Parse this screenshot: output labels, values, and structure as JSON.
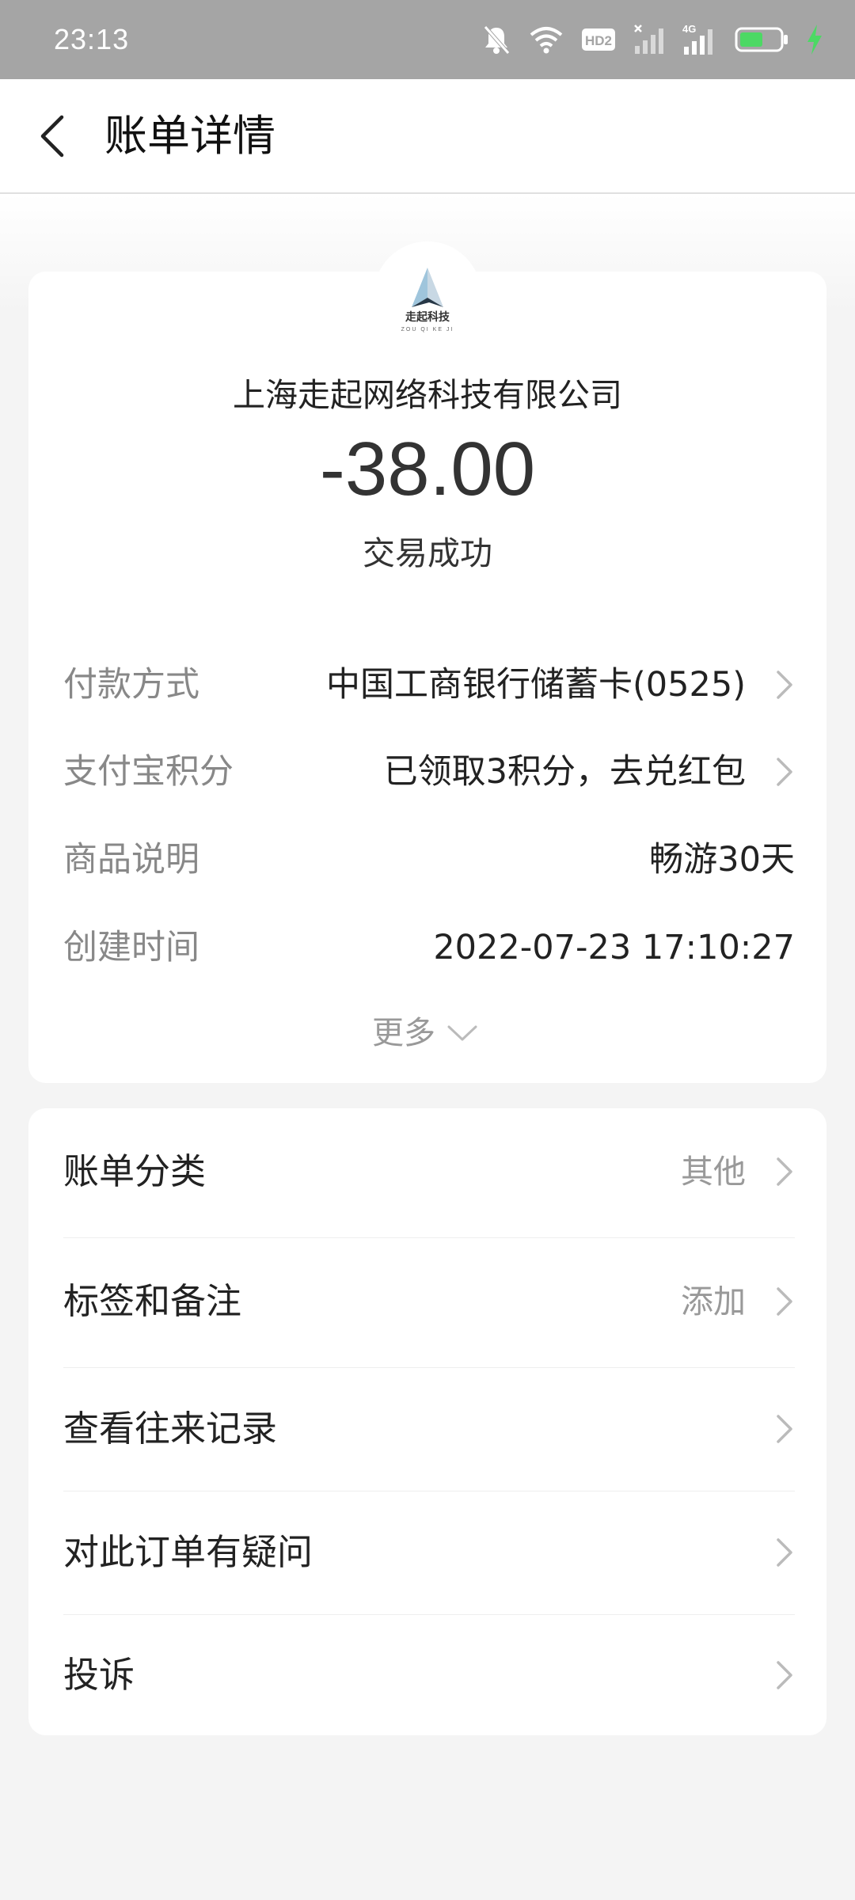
{
  "status_bar": {
    "time": "23:13",
    "icons": [
      "mute-bell-icon",
      "wifi-icon",
      "hd-icon",
      "signal-icon",
      "signal-4g-icon",
      "battery-icon",
      "charging-icon"
    ],
    "hd_label": "HD2",
    "network_label": "4G",
    "battery_color": "#4cd964"
  },
  "header": {
    "title": "账单详情"
  },
  "summary": {
    "merchant_name": "上海走起网络科技有限公司",
    "logo_text": "走起科技",
    "logo_subtext": "ZOU QI KE JI",
    "amount": "-38.00",
    "status": "交易成功",
    "details": [
      {
        "label": "付款方式",
        "value": "中国工商银行储蓄卡(0525)"
      },
      {
        "label": "支付宝积分",
        "value": "已领取3积分，去兑红包"
      },
      {
        "label": "商品说明",
        "value": "畅游30天"
      },
      {
        "label": "创建时间",
        "value": "2022-07-23 17:10:27"
      }
    ],
    "more_label": "更多"
  },
  "actions": [
    {
      "label": "账单分类",
      "value": "其他"
    },
    {
      "label": "标签和备注",
      "value": "添加"
    },
    {
      "label": "查看往来记录",
      "value": ""
    },
    {
      "label": "对此订单有疑问",
      "value": ""
    },
    {
      "label": "投诉",
      "value": ""
    }
  ]
}
